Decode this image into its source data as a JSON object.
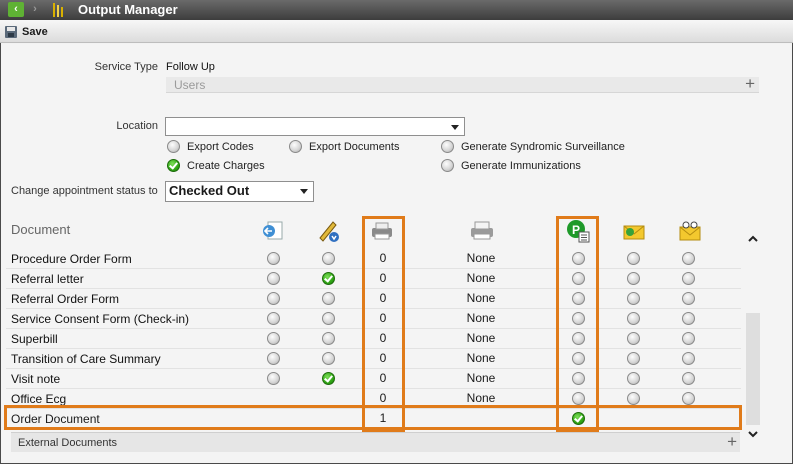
{
  "window": {
    "title": "Output Manager"
  },
  "toolbar": {
    "save_label": "Save"
  },
  "form": {
    "service_type_label": "Service Type",
    "service_type_value": "Follow Up",
    "users_label": "Users",
    "location_label": "Location",
    "location_value": "",
    "options": [
      {
        "label": "Export Codes",
        "checked": false
      },
      {
        "label": "Export Documents",
        "checked": false
      },
      {
        "label": "Generate Syndromic Surveillance",
        "checked": false
      },
      {
        "label": "Create Charges",
        "checked": true
      },
      {
        "label": "Generate Immunizations",
        "checked": false
      }
    ],
    "appt_status_label": "Change appointment status to",
    "appt_status_value": "Checked Out"
  },
  "grid": {
    "header_label": "Document",
    "rows": [
      {
        "name": "Procedure Order Form",
        "signed": false,
        "copies": "0",
        "printer": "None",
        "publish": false
      },
      {
        "name": "Referral letter",
        "signed": true,
        "copies": "0",
        "printer": "None",
        "publish": false
      },
      {
        "name": "Referral Order Form",
        "signed": false,
        "copies": "0",
        "printer": "None",
        "publish": false
      },
      {
        "name": "Service Consent Form (Check-in)",
        "signed": false,
        "copies": "0",
        "printer": "None",
        "publish": false
      },
      {
        "name": "Superbill",
        "signed": false,
        "copies": "0",
        "printer": "None",
        "publish": false
      },
      {
        "name": "Transition of Care Summary",
        "signed": false,
        "copies": "0",
        "printer": "None",
        "publish": false
      },
      {
        "name": "Visit note",
        "signed": true,
        "copies": "0",
        "printer": "None",
        "publish": false
      },
      {
        "name": "Office Ecg",
        "signed": false,
        "copies": "0",
        "printer": "None",
        "publish": false
      }
    ],
    "order_row": {
      "name": "Order Document",
      "copies": "1",
      "publish": true
    }
  },
  "external_documents_label": "External Documents",
  "colors": {
    "highlight": "#e07b1a",
    "check_green": "#2fa515",
    "titlebar": "#4a4a4a"
  },
  "icons": [
    "back-arrow-icon",
    "forward-arrow-icon",
    "app-icon",
    "save-disk-icon",
    "export-icon",
    "sign-pen-icon",
    "printer-copies-icon",
    "printer-icon",
    "publish-icon",
    "email-icon",
    "fax-icon",
    "chevron-up-icon",
    "chevron-down-icon",
    "plus-icon"
  ]
}
